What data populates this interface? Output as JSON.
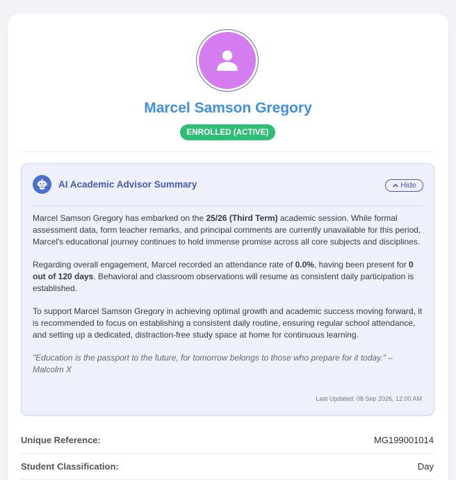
{
  "profile": {
    "name": "Marcel Samson Gregory",
    "status": "ENROLLED (ACTIVE)",
    "avatar_icon": "user-icon",
    "colors": {
      "name": "#3f8fe6",
      "badge": "#2dbd75",
      "avatar": "#d47cf0",
      "accent": "#4559b8"
    }
  },
  "ai_summary": {
    "title": "AI Academic Advisor Summary",
    "icon": "robot-icon",
    "hide_label": "Hide",
    "p1": {
      "a": "Marcel Samson Gregory has embarked on the ",
      "b": "25/26 (Third Term)",
      "c": " academic session. While formal assessment data, form teacher remarks, and principal comments are currently unavailable for this period, Marcel's educational journey continues to hold immense promise across all core subjects and disciplines."
    },
    "p2": {
      "a": "Regarding overall engagement, Marcel recorded an attendance rate of ",
      "b": "0.0%",
      "c": ", having been present for ",
      "d": "0 out of 120 days",
      "e": ". Behavioral and classroom observations will resume as consistent daily participation is established."
    },
    "p3": "To support Marcel Samson Gregory in achieving optimal growth and academic success moving forward, it is recommended to focus on establishing a consistent daily routine, ensuring regular school attendance, and setting up a dedicated, distraction-free study space at home for continuous learning.",
    "quote": "\"Education is the passport to the future, for tomorrow belongs to those who prepare for it today.\" – Malcolm X",
    "last_updated": "Last Updated: 08 Sep 2026, 12:00 AM"
  },
  "details": [
    {
      "label": "Unique Reference:",
      "value": "MG199001014"
    },
    {
      "label": "Student Classification:",
      "value": "Day"
    }
  ]
}
